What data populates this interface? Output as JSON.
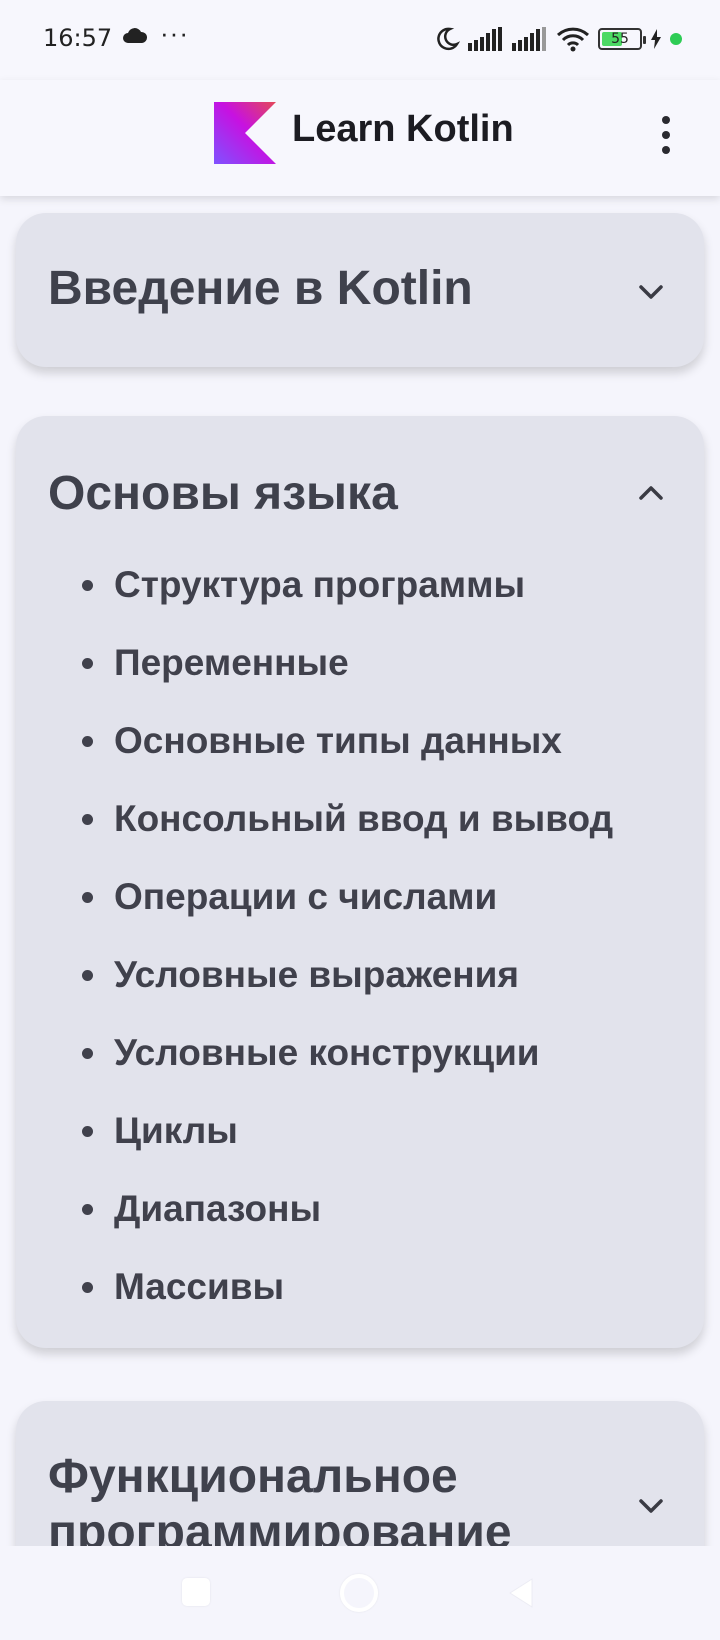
{
  "status_bar": {
    "time": "16:57",
    "dots": "···",
    "battery": "55",
    "battery_level": 0.55,
    "icons": [
      "cloud-icon",
      "moon-icon",
      "signal-icon",
      "signal-icon",
      "wifi-icon",
      "battery-icon",
      "charging-icon"
    ]
  },
  "app_bar": {
    "title": "Learn Kotlin",
    "logo": "kotlin-logo",
    "menu_icon": "more-vert-icon"
  },
  "sections": [
    {
      "title": "Введение в Kotlin",
      "expanded": false
    },
    {
      "title": "Основы языка",
      "expanded": true,
      "items": [
        "Структура программы",
        "Переменные",
        "Основные типы данных",
        "Консольный ввод и вывод",
        "Операции с числами",
        "Условные выражения",
        "Условные конструкции",
        "Циклы",
        "Диапазоны",
        "Массивы"
      ]
    },
    {
      "title_line1": "Функциональное",
      "title_line2": "программирование",
      "expanded": false
    }
  ],
  "colors": {
    "card_bg": "#e2e3ec",
    "text": "#3f414c",
    "page_bg": "#f5f5fc",
    "kotlin_gradient": [
      "#e44857",
      "#c711e1",
      "#7f52ff"
    ]
  },
  "nav_bar": {
    "icons": [
      "recents-icon",
      "home-icon",
      "back-icon"
    ]
  }
}
